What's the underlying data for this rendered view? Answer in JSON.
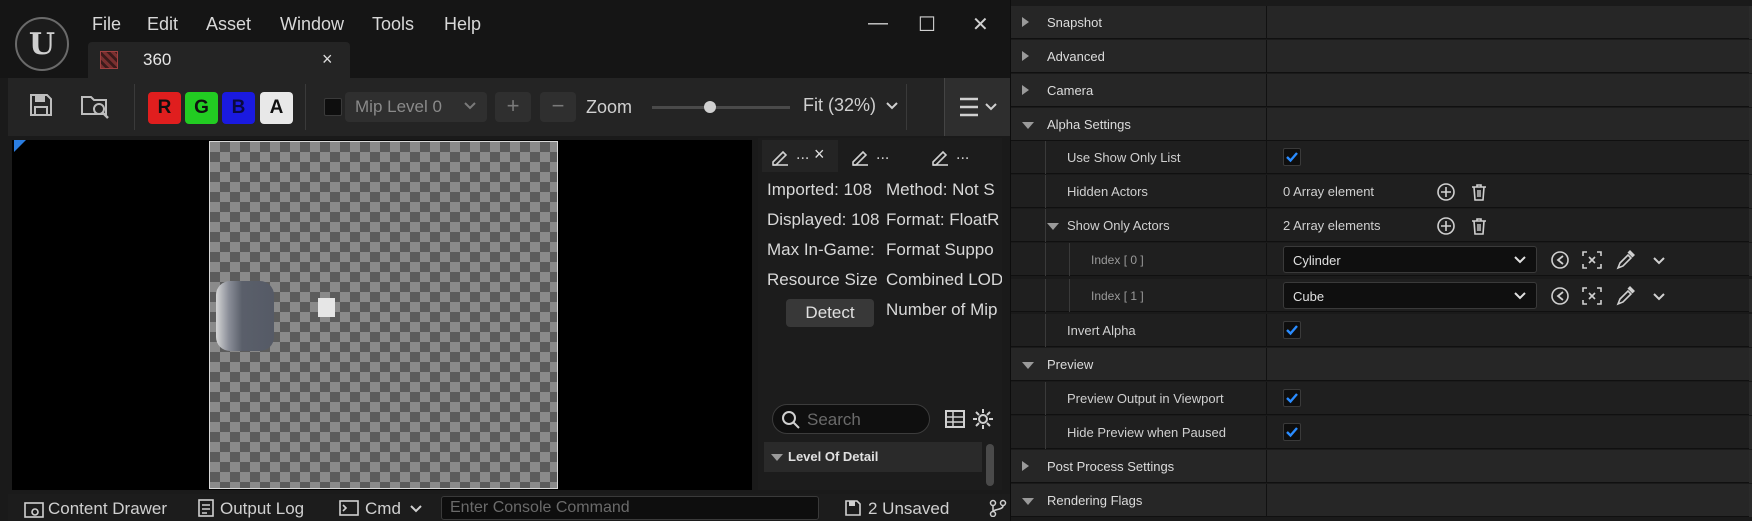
{
  "editor": {
    "menu": [
      "File",
      "Edit",
      "Asset",
      "Window",
      "Tools",
      "Help"
    ],
    "tab_title": "360",
    "tab_close": "×",
    "window_controls": {
      "minimize": "—",
      "maximize": "☐",
      "close": "✕"
    },
    "channels": [
      {
        "label": "R",
        "color": "#e01e1e"
      },
      {
        "label": "G",
        "color": "#22cc22"
      },
      {
        "label": "B",
        "color": "#1a1ae0"
      },
      {
        "label": "A",
        "color": "#e8e8e8"
      }
    ],
    "mip_level": "Mip Level 0",
    "plus": "+",
    "minus": "−",
    "zoom_label": "Zoom",
    "zoom_value": 0.42,
    "fit_label": "Fit (32%)",
    "details_tabs": [
      "...",
      "...",
      "..."
    ],
    "info_left": [
      "Imported: 108",
      "Displayed: 108",
      "Max In-Game:",
      "Resource Size"
    ],
    "info_right": [
      "Method: Not S",
      "Format: FloatR",
      "Format Suppo",
      "Combined LOD",
      "Number of Mip"
    ],
    "detect_label": "Detect",
    "search_placeholder": "Search",
    "lod_header": "Level Of Detail"
  },
  "statusbar": {
    "content_drawer": "Content Drawer",
    "output_log": "Output Log",
    "cmd": "Cmd",
    "console_placeholder": "Enter Console Command",
    "unsaved": "2 Unsaved"
  },
  "details": {
    "rows": [
      {
        "type": "category",
        "label": "Snapshot",
        "expanded": false
      },
      {
        "type": "category",
        "label": "Advanced",
        "expanded": false
      },
      {
        "type": "category",
        "label": "Camera",
        "expanded": false
      },
      {
        "type": "category",
        "label": "Alpha Settings",
        "expanded": true
      },
      {
        "type": "bool",
        "label": "Use Show Only List",
        "checked": true
      },
      {
        "type": "array",
        "label": "Hidden Actors",
        "value": "0 Array element"
      },
      {
        "type": "array",
        "label": "Show Only Actors",
        "value": "2 Array elements",
        "expanded": true
      },
      {
        "type": "index",
        "label": "Index [ 0 ]",
        "value": "Cylinder"
      },
      {
        "type": "index",
        "label": "Index [ 1 ]",
        "value": "Cube"
      },
      {
        "type": "bool",
        "label": "Invert Alpha",
        "checked": true
      },
      {
        "type": "category",
        "label": "Preview",
        "expanded": true
      },
      {
        "type": "bool",
        "label": "Preview Output in Viewport",
        "checked": true
      },
      {
        "type": "bool",
        "label": "Hide Preview when Paused",
        "checked": true
      },
      {
        "type": "category",
        "label": "Post Process Settings",
        "expanded": false
      },
      {
        "type": "category",
        "label": "Rendering Flags",
        "expanded": true
      }
    ]
  }
}
